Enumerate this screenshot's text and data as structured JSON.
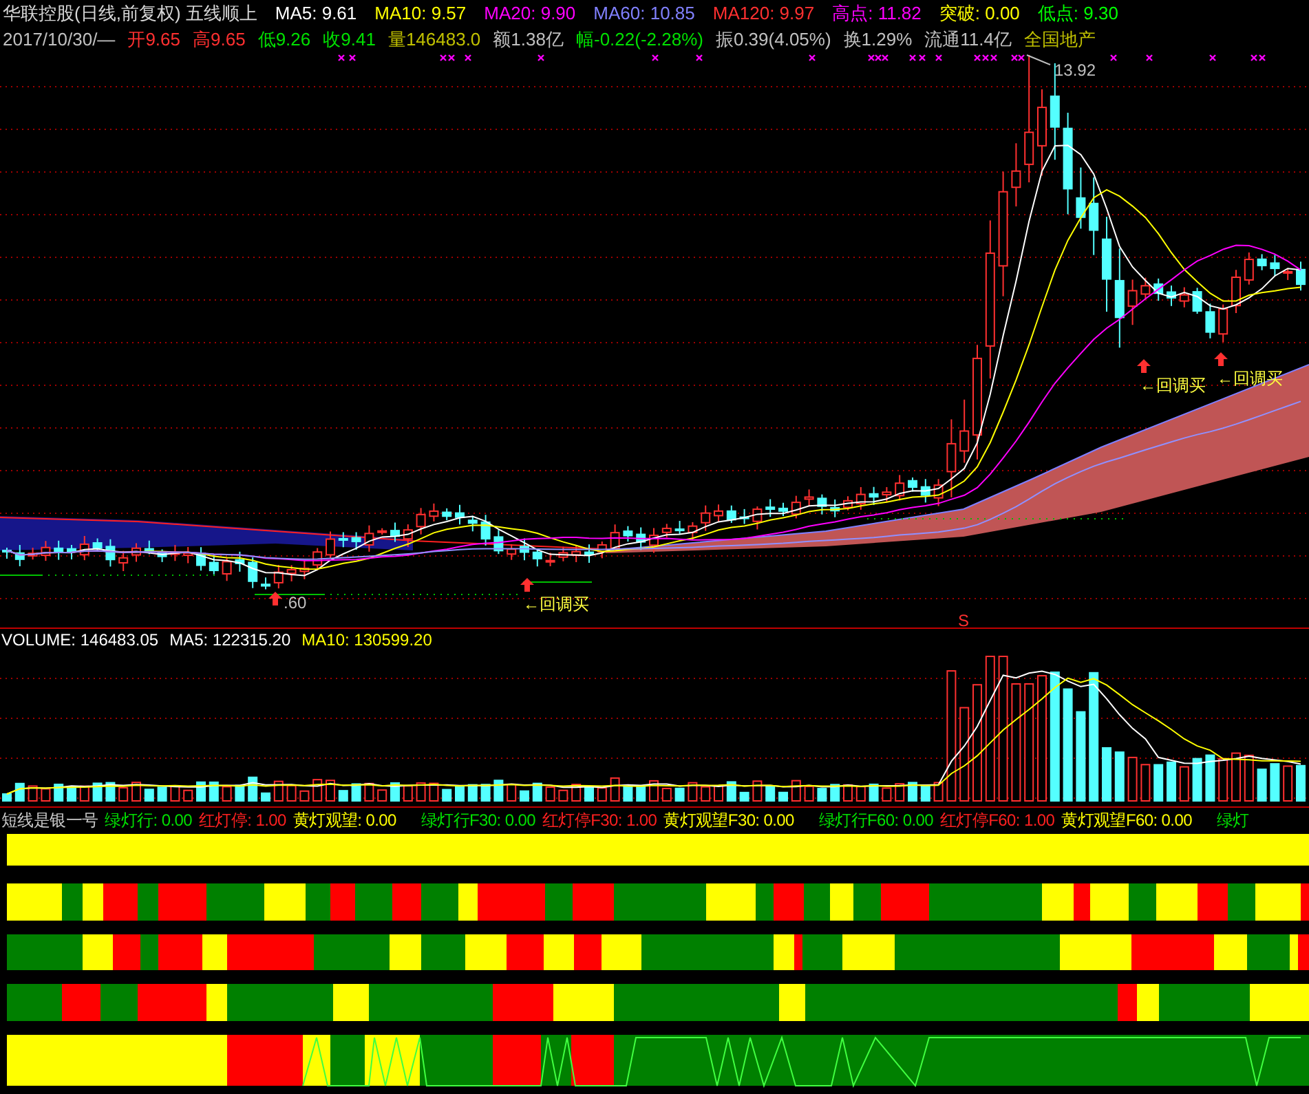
{
  "title": {
    "stock": "华联控股(日线,前复权)",
    "strategy": "五线顺上"
  },
  "indicators": [
    {
      "label": "MA5: 9.61",
      "color": "#ffffff"
    },
    {
      "label": "MA10: 9.57",
      "color": "#ffff00"
    },
    {
      "label": "MA20: 9.90",
      "color": "#ff00ff"
    },
    {
      "label": "MA60: 10.85",
      "color": "#8080ff"
    },
    {
      "label": "MA120: 9.97",
      "color": "#ff3030"
    },
    {
      "label": "高点: 11.82",
      "color": "#ff00ff"
    },
    {
      "label": "突破: 0.00",
      "color": "#ffff00"
    },
    {
      "label": "低点: 9.30",
      "color": "#00ff00"
    }
  ],
  "quote": [
    {
      "label": "2017/10/30/—",
      "color": "#c0c0c0"
    },
    {
      "label": "开9.65",
      "color": "#ff3030"
    },
    {
      "label": "高9.65",
      "color": "#ff3030"
    },
    {
      "label": "低9.26",
      "color": "#00e000"
    },
    {
      "label": "收9.41",
      "color": "#00e000"
    },
    {
      "label": "量146483.0",
      "color": "#c0c000"
    },
    {
      "label": "额1.38亿",
      "color": "#c0c0c0"
    },
    {
      "label": "幅-0.22(-2.28%)",
      "color": "#00e000"
    },
    {
      "label": "振0.39(4.05%)",
      "color": "#c0c0c0"
    },
    {
      "label": "换1.29%",
      "color": "#c0c0c0"
    },
    {
      "label": "流通11.4亿",
      "color": "#c0c0c0"
    },
    {
      "label": "全国地产",
      "color": "#c0c000"
    }
  ],
  "chart": {
    "annotations": [
      {
        "kind": "peak",
        "text": "13.92"
      },
      {
        "kind": "low",
        "text": ".60"
      },
      {
        "kind": "buy",
        "text": "←回调买"
      },
      {
        "kind": "buy",
        "text": "←回调买"
      },
      {
        "kind": "buy",
        "text": "←回调买"
      },
      {
        "kind": "sell",
        "text": "S"
      }
    ]
  },
  "volume": {
    "legend": [
      {
        "label": "VOLUME: 146483.05",
        "color": "#ffffff"
      },
      {
        "label": "MA5: 122315.20",
        "color": "#ffffff"
      },
      {
        "label": "MA10: 130599.20",
        "color": "#ffff00"
      }
    ]
  },
  "signals": {
    "name": "短线是银一号",
    "legend": [
      {
        "label": "绿灯行: 0.00",
        "color": "#00e000"
      },
      {
        "label": "红灯停: 1.00",
        "color": "#ff2020"
      },
      {
        "label": "黄灯观望: 0.00",
        "color": "#ffff00"
      },
      {
        "label": "绿灯行F30: 0.00",
        "color": "#00e000"
      },
      {
        "label": "红灯停F30: 1.00",
        "color": "#ff2020"
      },
      {
        "label": "黄灯观望F30: 0.00",
        "color": "#ffff00"
      },
      {
        "label": "绿灯行F60: 0.00",
        "color": "#00e000"
      },
      {
        "label": "红灯停F60: 1.00",
        "color": "#ff2020"
      },
      {
        "label": "黄灯观望F60: 0.00",
        "color": "#ffff00"
      },
      {
        "label": "绿灯",
        "color": "#00e000"
      }
    ]
  }
}
